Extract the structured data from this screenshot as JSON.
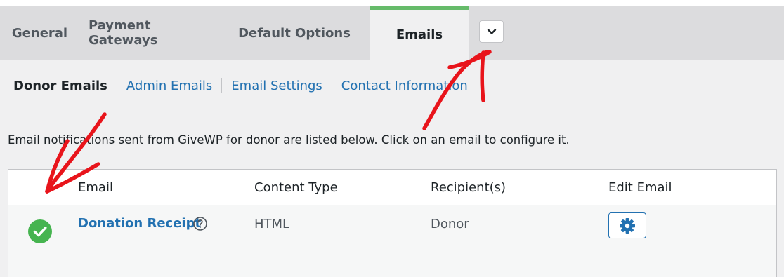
{
  "tabs": [
    {
      "label": "General"
    },
    {
      "label": "Payment Gateways"
    },
    {
      "label": "Default Options"
    },
    {
      "label": "Emails",
      "active": true
    }
  ],
  "tabs_more_icon": "chevron-down-icon",
  "subnav": [
    {
      "label": "Donor Emails",
      "current": true
    },
    {
      "label": "Admin Emails"
    },
    {
      "label": "Email Settings"
    },
    {
      "label": "Contact Information"
    }
  ],
  "description": "Email notifications sent from GiveWP for donor are listed below. Click on an email to configure it.",
  "table": {
    "headers": {
      "email": "Email",
      "content_type": "Content Type",
      "recipients": "Recipient(s)",
      "edit": "Edit Email"
    },
    "rows": [
      {
        "status_icon": "check-circle-icon",
        "email": "Donation Receipt",
        "help_icon": "question-circle-icon",
        "content_type": "HTML",
        "recipients": "Donor",
        "edit_icon": "gear-icon"
      }
    ]
  },
  "colors": {
    "accent": "#2271b1",
    "tab_active_border": "#66bb6a",
    "status_enabled": "#46b450",
    "annotation": "#e8141b"
  }
}
